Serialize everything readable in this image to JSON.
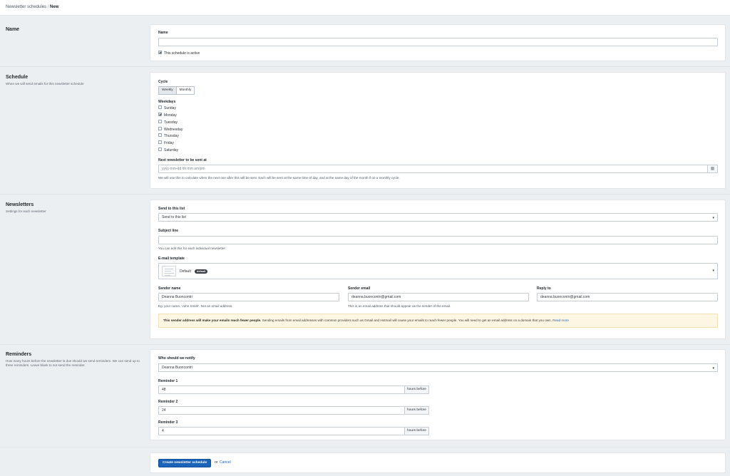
{
  "breadcrumb": {
    "parent": "Newsletter schedules",
    "separator": "/",
    "current": "New"
  },
  "name_section": {
    "title": "Name",
    "name_label": "Name",
    "name_value": "",
    "active_label": "This schedule is active",
    "active_checked": true
  },
  "schedule_section": {
    "title": "Schedule",
    "description": "When we will send emails for this newsletter schedule",
    "cycle_label": "Cycle",
    "cycle_options": [
      "Weekly",
      "Monthly"
    ],
    "cycle_selected": "Weekly",
    "weekdays_label": "Weekdays",
    "weekdays": [
      {
        "label": "Sunday",
        "checked": false
      },
      {
        "label": "Monday",
        "checked": true
      },
      {
        "label": "Tuesday",
        "checked": false
      },
      {
        "label": "Wednesday",
        "checked": false
      },
      {
        "label": "Thursday",
        "checked": false
      },
      {
        "label": "Friday",
        "checked": false
      },
      {
        "label": "Saturday",
        "checked": false
      }
    ],
    "next_label": "Next newsletter to be sent at",
    "next_placeholder": "yyyy-mm-dd hh:mm am/pm",
    "calendar_icon": "calendar-icon",
    "next_help": "We will use this to calculate when the next one after this will be sent. Each will be sent at the same time of day, and at the same day of the month if on a monthly cycle."
  },
  "newsletters_section": {
    "title": "Newsletters",
    "description": "Settings for each newsletter",
    "list_label": "Send to this list",
    "list_value": "Send to this list",
    "subject_label": "Subject line",
    "subject_value": "",
    "subject_help": "You can edit this for each individual newsletter",
    "template_label": "E-mail template",
    "template_name": "Default",
    "template_badge": "default",
    "sender_name_label": "Sender name",
    "sender_name_value": "Deanna Buoncontri",
    "sender_name_help": "Eg. your name, 'John Smith'. Not an email address.",
    "sender_email_label": "Sender email",
    "sender_email_value": "deanna.buoncontri@gmail.com",
    "sender_email_help": "This is an email address that should appear as the sender of the email.",
    "reply_to_label": "Reply to",
    "reply_to_value": "deanna.buoncontri@gmail.com",
    "warning_bold": "This sender address will make your emails reach fewer people.",
    "warning_text": " Sending emails from email addresses with common providers such as Gmail and Hotmail will cause your emails to reach fewer people. You will need to get an email address on a domain that you own. ",
    "warning_link": "Read more"
  },
  "reminders_section": {
    "title": "Reminders",
    "description": "How many hours before the newsletter is due should we send reminders. We can send up to three reminders. Leave blank to not send the reminder.",
    "notify_label": "Who should we notify",
    "notify_value": "Deanna Buoncontri",
    "reminders": [
      {
        "label": "Reminder 1",
        "value": "48",
        "unit": "hours before"
      },
      {
        "label": "Reminder 2",
        "value": "24",
        "unit": "hours before"
      },
      {
        "label": "Reminder 3",
        "value": "4",
        "unit": "hours before"
      }
    ]
  },
  "actions": {
    "create_label": "Create newsletter schedule",
    "or_text": "or",
    "cancel_label": "Cancel"
  },
  "colors": {
    "primary": "#1b63b8",
    "page_bg": "#eceff2",
    "warning_bg": "#fdf6e3",
    "link": "#1d5fbf"
  }
}
